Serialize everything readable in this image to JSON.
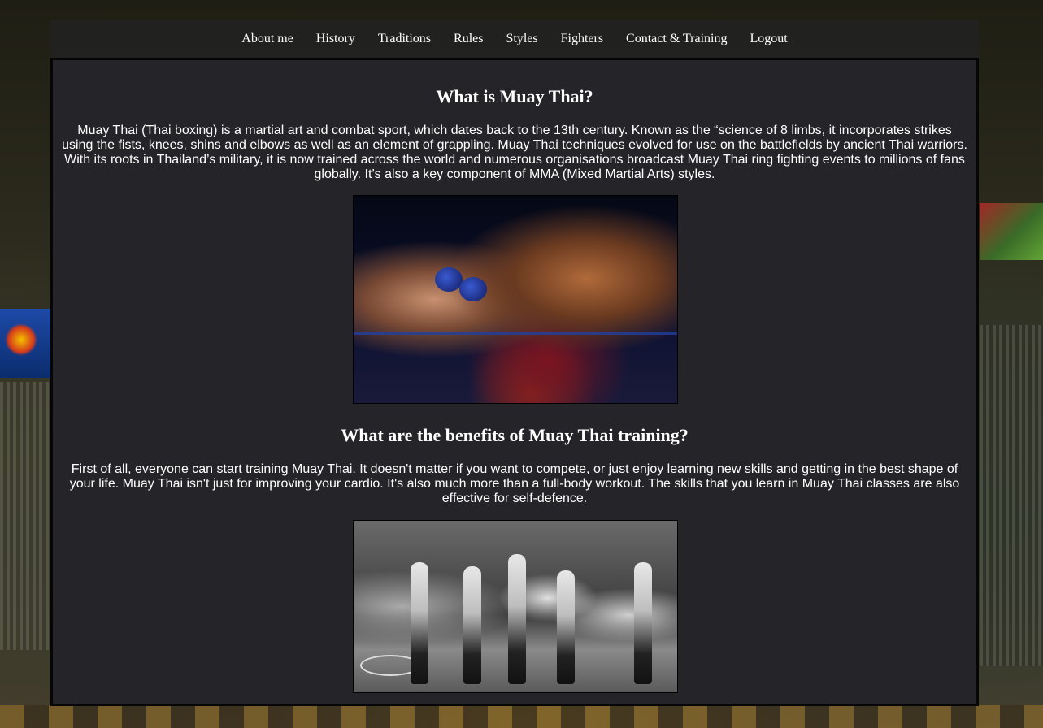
{
  "nav": {
    "items": [
      {
        "label": "About me"
      },
      {
        "label": "History"
      },
      {
        "label": "Traditions"
      },
      {
        "label": "Rules"
      },
      {
        "label": "Styles"
      },
      {
        "label": "Fighters"
      },
      {
        "label": "Contact & Training"
      },
      {
        "label": "Logout"
      }
    ]
  },
  "sections": [
    {
      "heading": "What is Muay Thai?",
      "text": "Muay Thai (Thai boxing) is a martial art and combat sport, which dates back to the 13th century. Known as the “science of 8 limbs, it incorporates strikes using the fists, knees, shins and elbows as well as an element of grappling. Muay Thai techniques evolved for use on the battlefields by ancient Thai warriors. With its roots in Thailand’s military, it is now trained across the world and numerous organisations broadcast Muay Thai ring fighting events to millions of fans globally. It’s also a key component of MMA (Mixed Martial Arts) styles."
    },
    {
      "heading": "What are the benefits of Muay Thai training?",
      "text": "First of all, everyone can start training Muay Thai. It doesn't matter if you want to compete, or just enjoy learning new skills and getting in the best shape of your life. Muay Thai isn't just for improving your cardio. It's also much more than a full-body workout. The skills that you learn in Muay Thai classes are also effective for self-defence."
    }
  ],
  "colors": {
    "nav_bg": "#212120",
    "panel_bg": "#252429",
    "text": "#ffffff"
  }
}
